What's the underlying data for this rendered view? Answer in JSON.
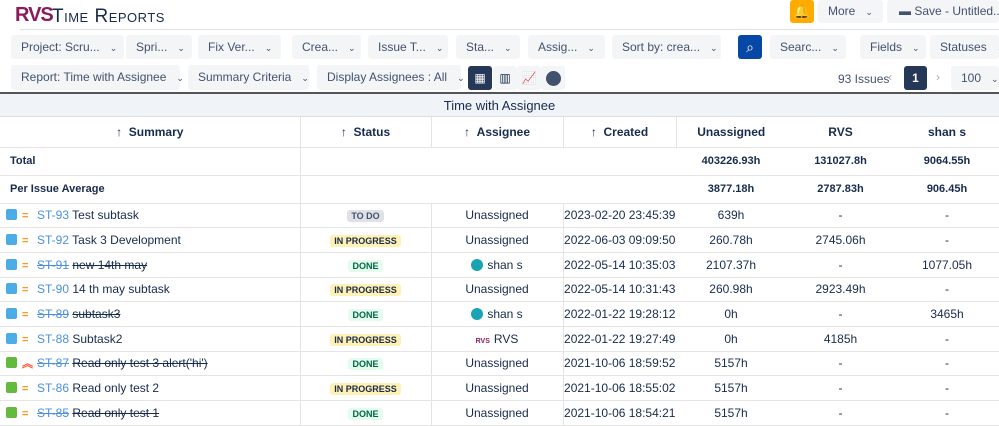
{
  "app": {
    "logo": "RVS",
    "title": "Time Reports"
  },
  "top_actions": {
    "more": "More",
    "save": "Save - Untitled..."
  },
  "filters": [
    "Project: Scru...",
    "Spri...",
    "Fix Ver...",
    "Crea...",
    "Issue T...",
    "Sta...",
    "Assig...",
    "Sort by: crea..."
  ],
  "filters_right": {
    "search": "Searc...",
    "fields": "Fields",
    "statuses": "Statuses"
  },
  "report_bar": {
    "report": "Report: Time with Assignee",
    "summary": "Summary Criteria",
    "display": "Display Assignees : All"
  },
  "pagination": {
    "count": "93 Issues",
    "page": "1",
    "page_size": "100"
  },
  "report_title": "Time with Assignee",
  "columns": {
    "summary": "Summary",
    "status": "Status",
    "assignee": "Assignee",
    "created": "Created",
    "unassigned": "Unassigned",
    "rvs": "RVS",
    "shan": "shan s"
  },
  "sort_arrow": "↑",
  "totals": {
    "label": "Total",
    "unassigned": "403226.93h",
    "rvs": "131027.8h",
    "shan": "9064.55h"
  },
  "average": {
    "label": "Per Issue Average",
    "unassigned": "3877.18h",
    "rvs": "2787.83h",
    "shan": "906.45h"
  },
  "rows": [
    {
      "key": "ST-93",
      "summary": "Test subtask",
      "status": "TO DO",
      "assignee": "Unassigned",
      "created": "2023-02-20 23:45:39",
      "unassigned": "639h",
      "rvs": "-",
      "shan": "-"
    },
    {
      "key": "ST-92",
      "summary": "Task 3 Development",
      "status": "IN PROGRESS",
      "assignee": "Unassigned",
      "created": "2022-06-03 09:09:50",
      "unassigned": "260.78h",
      "rvs": "2745.06h",
      "shan": "-"
    },
    {
      "key": "ST-91",
      "summary": "new 14th may",
      "status": "DONE",
      "assignee": "shan s",
      "created": "2022-05-14 10:35:03",
      "unassigned": "2107.37h",
      "rvs": "-",
      "shan": "1077.05h"
    },
    {
      "key": "ST-90",
      "summary": "14 th may subtask",
      "status": "IN PROGRESS",
      "assignee": "Unassigned",
      "created": "2022-05-14 10:31:43",
      "unassigned": "260.98h",
      "rvs": "2923.49h",
      "shan": "-"
    },
    {
      "key": "ST-89",
      "summary": "subtask3",
      "status": "DONE",
      "assignee": "shan s",
      "created": "2022-01-22 19:28:12",
      "unassigned": "0h",
      "rvs": "-",
      "shan": "3465h"
    },
    {
      "key": "ST-88",
      "summary": "Subtask2",
      "status": "IN PROGRESS",
      "assignee": "RVS",
      "created": "2022-01-22 19:27:49",
      "unassigned": "0h",
      "rvs": "4185h",
      "shan": "-"
    },
    {
      "key": "ST-87",
      "summary": "Read only test 3 alert('hi')",
      "status": "DONE",
      "assignee": "Unassigned",
      "created": "2021-10-06 18:59:52",
      "unassigned": "5157h",
      "rvs": "-",
      "shan": "-"
    },
    {
      "key": "ST-86",
      "summary": "Read only test 2",
      "status": "IN PROGRESS",
      "assignee": "Unassigned",
      "created": "2021-10-06 18:55:02",
      "unassigned": "5157h",
      "rvs": "-",
      "shan": "-"
    },
    {
      "key": "ST-85",
      "summary": "Read only test 1",
      "status": "DONE",
      "assignee": "Unassigned",
      "created": "2021-10-06 18:54:21",
      "unassigned": "5157h",
      "rvs": "-",
      "shan": "-"
    }
  ],
  "row_meta": [
    {
      "type": "subtask",
      "priority": "medium",
      "done": false
    },
    {
      "type": "subtask",
      "priority": "medium",
      "done": false
    },
    {
      "type": "subtask",
      "priority": "medium",
      "done": true
    },
    {
      "type": "subtask",
      "priority": "medium",
      "done": false
    },
    {
      "type": "subtask",
      "priority": "medium",
      "done": true
    },
    {
      "type": "subtask",
      "priority": "medium",
      "done": false
    },
    {
      "type": "story",
      "priority": "highest",
      "done": true
    },
    {
      "type": "story",
      "priority": "medium",
      "done": false
    },
    {
      "type": "story",
      "priority": "medium",
      "done": true
    }
  ],
  "colors": {
    "accent": "#0747a6",
    "bell": "#ffab00",
    "link": "#4a8fe0",
    "subtask": "#4bade8",
    "story": "#63ba3c"
  }
}
